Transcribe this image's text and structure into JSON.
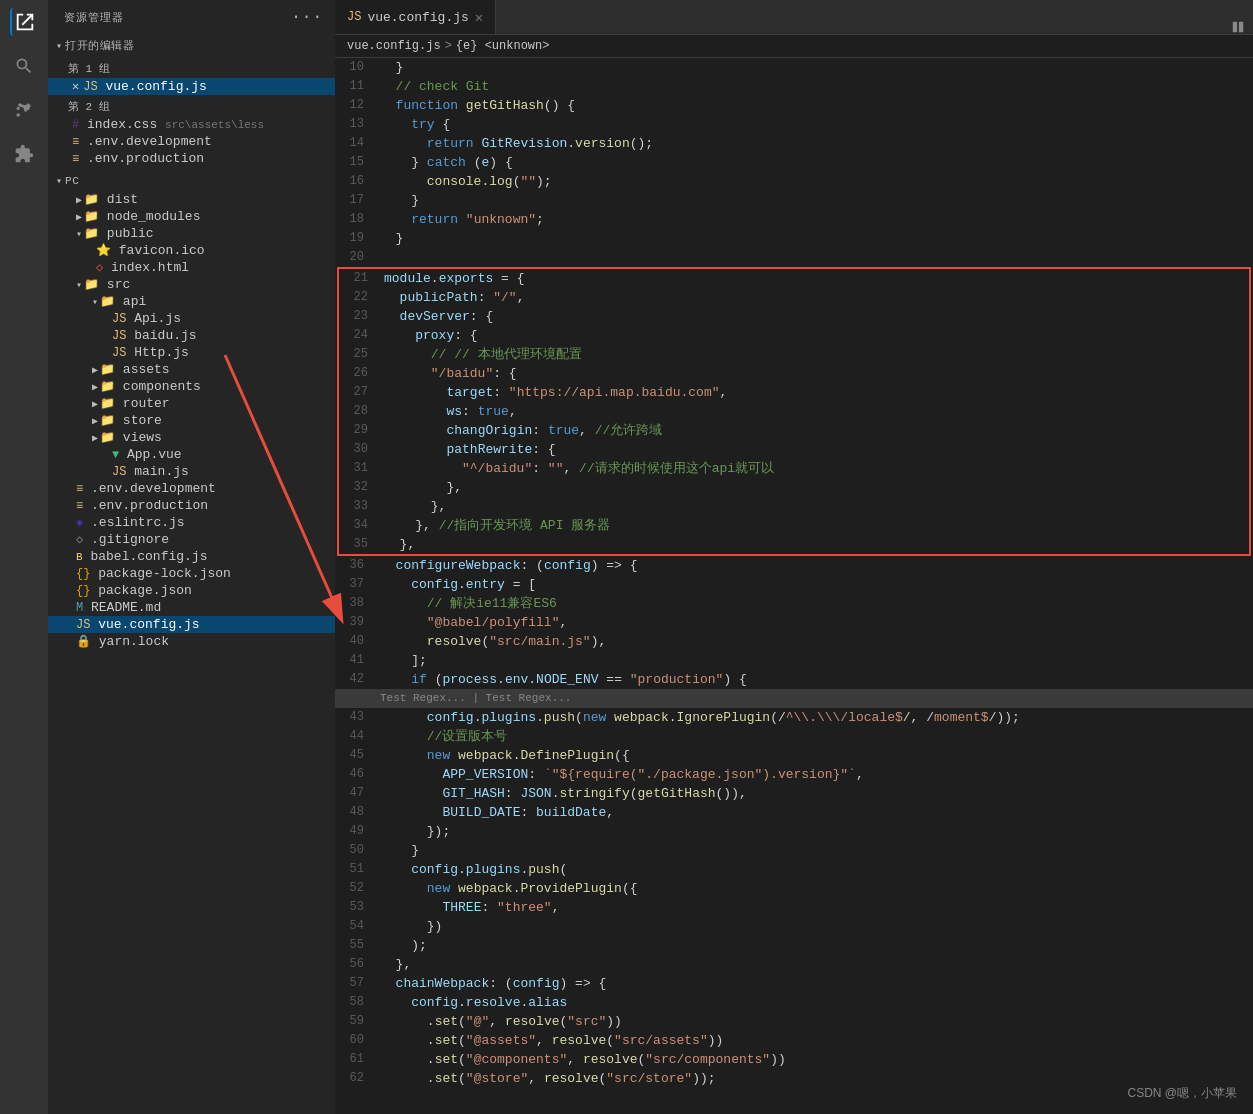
{
  "sidebar": {
    "header": "资源管理器",
    "openEditors": "打开的编辑器",
    "group1": "第 1 组",
    "group2": "第 2 组",
    "active_file": "vue.config.js",
    "group2_files": [
      {
        "name": "index.css",
        "extra": "src\\assets\\less",
        "icon": "css"
      },
      {
        "name": ".env.development",
        "icon": "env"
      },
      {
        "name": ".env.production",
        "icon": "env"
      }
    ],
    "pc_section": "PC",
    "tree": [
      {
        "label": "dist",
        "type": "folder",
        "indent": 1
      },
      {
        "label": "node_modules",
        "type": "folder",
        "indent": 1
      },
      {
        "label": "public",
        "type": "folder",
        "indent": 1,
        "open": true
      },
      {
        "label": "favicon.ico",
        "type": "star",
        "indent": 2
      },
      {
        "label": "index.html",
        "type": "html",
        "indent": 2
      },
      {
        "label": "src",
        "type": "folder",
        "indent": 1,
        "open": true
      },
      {
        "label": "api",
        "type": "folder",
        "indent": 2,
        "open": true
      },
      {
        "label": "Api.js",
        "type": "js",
        "indent": 3
      },
      {
        "label": "baidu.js",
        "type": "js",
        "indent": 3
      },
      {
        "label": "Http.js",
        "type": "js",
        "indent": 3
      },
      {
        "label": "assets",
        "type": "folder",
        "indent": 2
      },
      {
        "label": "components",
        "type": "folder",
        "indent": 2
      },
      {
        "label": "router",
        "type": "folder",
        "indent": 2
      },
      {
        "label": "store",
        "type": "folder",
        "indent": 2
      },
      {
        "label": "views",
        "type": "folder",
        "indent": 2
      },
      {
        "label": "App.vue",
        "type": "vue",
        "indent": 2
      },
      {
        "label": "main.js",
        "type": "js",
        "indent": 2
      },
      {
        "label": ".env.development",
        "type": "env",
        "indent": 1
      },
      {
        "label": ".env.production",
        "type": "env",
        "indent": 1
      },
      {
        "label": ".eslintrc.js",
        "type": "eslint",
        "indent": 1
      },
      {
        "label": ".gitignore",
        "type": "git",
        "indent": 1
      },
      {
        "label": "babel.config.js",
        "type": "babel",
        "indent": 1
      },
      {
        "label": "package-lock.json",
        "type": "json",
        "indent": 1
      },
      {
        "label": "package.json",
        "type": "json",
        "indent": 1
      },
      {
        "label": "README.md",
        "type": "md",
        "indent": 1
      },
      {
        "label": "vue.config.js",
        "type": "js",
        "indent": 1,
        "active": true
      },
      {
        "label": "yarn.lock",
        "type": "lock",
        "indent": 1
      }
    ]
  },
  "tabs": [
    {
      "label": "vue.config.js",
      "icon": "js",
      "active": true,
      "closable": true
    }
  ],
  "breadcrumb": [
    "vue.config.js",
    ">",
    "{e} <unknown>"
  ],
  "code_lines": [
    {
      "n": 10,
      "content": "  }"
    },
    {
      "n": 11,
      "content": "  // check Git"
    },
    {
      "n": 12,
      "content": "  function getGitHash() {"
    },
    {
      "n": 13,
      "content": "    try {"
    },
    {
      "n": 14,
      "content": "      return GitRevision.version();"
    },
    {
      "n": 15,
      "content": "    } catch (e) {"
    },
    {
      "n": 16,
      "content": "      console.log(\"\");"
    },
    {
      "n": 17,
      "content": "    }"
    },
    {
      "n": 18,
      "content": "    return \"unknown\";"
    },
    {
      "n": 19,
      "content": "  }"
    },
    {
      "n": 20,
      "content": ""
    },
    {
      "n": 21,
      "content": "module.exports = {",
      "highlight_start": true
    },
    {
      "n": 22,
      "content": "  publicPath: \"/\","
    },
    {
      "n": 23,
      "content": "  devServer: {"
    },
    {
      "n": 24,
      "content": "    proxy: {"
    },
    {
      "n": 25,
      "content": "      // // 本地代理环境配置"
    },
    {
      "n": 26,
      "content": "      \"/baidu\": {"
    },
    {
      "n": 27,
      "content": "        target: \"https://api.map.baidu.com\","
    },
    {
      "n": 28,
      "content": "        ws: true,"
    },
    {
      "n": 29,
      "content": "        changOrigin: true, //允许跨域"
    },
    {
      "n": 30,
      "content": "        pathRewrite: {"
    },
    {
      "n": 31,
      "content": "          \"^/baidu\": \"\", //请求的时候使用这个api就可以"
    },
    {
      "n": 32,
      "content": "        },"
    },
    {
      "n": 33,
      "content": "      },"
    },
    {
      "n": 34,
      "content": "    }, //指向开发环境 API 服务器"
    },
    {
      "n": 35,
      "content": "  },",
      "highlight_end": true
    },
    {
      "n": 36,
      "content": "  configureWebpack: (config) => {"
    },
    {
      "n": 37,
      "content": "    config.entry = ["
    },
    {
      "n": 38,
      "content": "      // 解决ie11兼容ES6"
    },
    {
      "n": 39,
      "content": "      \"@babel/polyfill\","
    },
    {
      "n": 40,
      "content": "      resolve(\"src/main.js\"),"
    },
    {
      "n": 41,
      "content": "    ];"
    },
    {
      "n": 42,
      "content": "    if (process.env.NODE_ENV == \"production\") {"
    },
    {
      "n": 42.1,
      "content": "      Test Regex... | Test Regex..."
    },
    {
      "n": 43,
      "content": "      config.plugins.push(new webpack.IgnorePlugin(/^\\.\\/locale$/, /moment$/));"
    },
    {
      "n": 44,
      "content": "      //设置版本号"
    },
    {
      "n": 45,
      "content": "      new webpack.DefinePlugin({"
    },
    {
      "n": 46,
      "content": "        APP_VERSION: `\"${require(\"./package.json\").version}\"`,"
    },
    {
      "n": 47,
      "content": "        GIT_HASH: JSON.stringify(getGitHash()),"
    },
    {
      "n": 48,
      "content": "        BUILD_DATE: buildDate,"
    },
    {
      "n": 49,
      "content": "      });"
    },
    {
      "n": 50,
      "content": "    }"
    },
    {
      "n": 51,
      "content": "    config.plugins.push("
    },
    {
      "n": 52,
      "content": "      new webpack.ProvidePlugin({"
    },
    {
      "n": 53,
      "content": "        THREE: \"three\","
    },
    {
      "n": 54,
      "content": "      })"
    },
    {
      "n": 55,
      "content": "    );"
    },
    {
      "n": 56,
      "content": "  },"
    },
    {
      "n": 57,
      "content": "  chainWebpack: (config) => {"
    },
    {
      "n": 58,
      "content": "    config.resolve.alias"
    },
    {
      "n": 59,
      "content": "      .set(\"@\", resolve(\"src\"))"
    },
    {
      "n": 60,
      "content": "      .set(\"@assets\", resolve(\"src/assets\"))"
    },
    {
      "n": 61,
      "content": "      .set(\"@components\", resolve(\"src/components\"))"
    },
    {
      "n": 62,
      "content": "      .set(\"@store\", resolve(\"src/store\"));"
    }
  ],
  "watermark": "CSDN @嗯，小苹果"
}
